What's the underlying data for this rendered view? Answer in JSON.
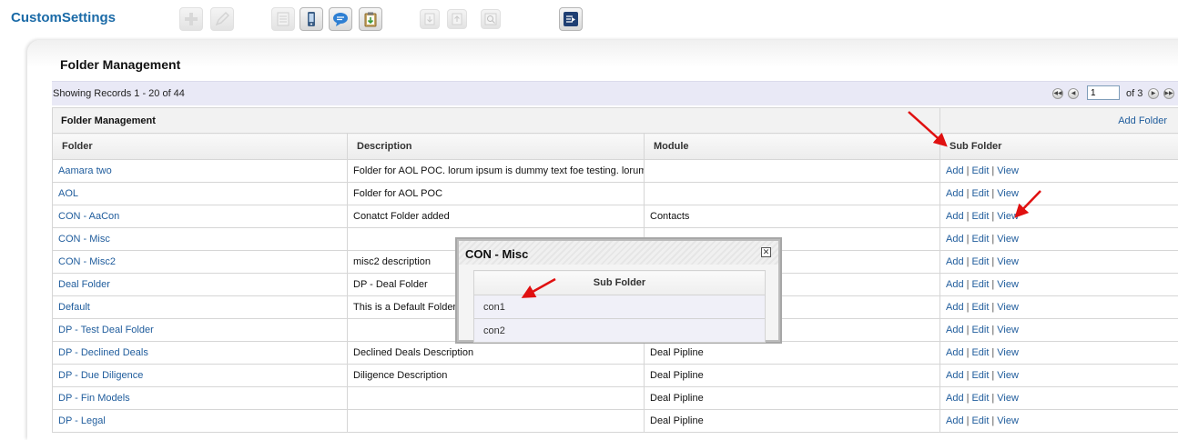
{
  "app": {
    "title": "CustomSettings"
  },
  "toolbar": {
    "buttons": [
      {
        "name": "add-icon",
        "state": "disabled"
      },
      {
        "name": "edit-icon",
        "state": "disabled"
      },
      {
        "name": "list-icon",
        "state": "disabled"
      },
      {
        "name": "mobile-icon",
        "state": "enabled"
      },
      {
        "name": "chat-bubble-icon",
        "state": "enabled"
      },
      {
        "name": "clipboard-icon",
        "state": "enabled"
      },
      {
        "name": "move-down-icon",
        "state": "disabled"
      },
      {
        "name": "move-up-icon",
        "state": "disabled"
      },
      {
        "name": "search-window-icon",
        "state": "disabled"
      },
      {
        "name": "export-icon",
        "state": "enabled"
      }
    ]
  },
  "panel": {
    "title": "Folder Management"
  },
  "records": {
    "summary": "Showing Records 1 - 20 of 44"
  },
  "pager": {
    "current_page": "1",
    "of_label": "of 3"
  },
  "grid": {
    "group_title": "Folder Management",
    "add_folder_label": "Add Folder",
    "columns": [
      "Folder",
      "Description",
      "Module",
      "Sub Folder"
    ],
    "action_labels": {
      "add": "Add",
      "edit": "Edit",
      "view": "View"
    },
    "rows": [
      {
        "folder": "Aamara two",
        "description": "Folder for AOL POC. lorum ipsum is dummy text foe testing. lorum ipsum is dummy text",
        "module": ""
      },
      {
        "folder": "AOL",
        "description": "Folder for AOL POC",
        "module": ""
      },
      {
        "folder": "CON - AaCon",
        "description": "Conatct Folder added",
        "module": "Contacts"
      },
      {
        "folder": "CON - Misc",
        "description": "",
        "module": ""
      },
      {
        "folder": "CON - Misc2",
        "description": "misc2 description",
        "module": ""
      },
      {
        "folder": "Deal Folder",
        "description": "DP - Deal Folder",
        "module": ""
      },
      {
        "folder": "Default",
        "description": "This is a Default Folder",
        "module": ""
      },
      {
        "folder": "DP - Test Deal Folder",
        "description": "",
        "module": ""
      },
      {
        "folder": "DP - Declined Deals",
        "description": "Declined Deals Description",
        "module": "Deal Pipline"
      },
      {
        "folder": "DP - Due Diligence",
        "description": "Diligence Description",
        "module": "Deal Pipline"
      },
      {
        "folder": "DP - Fin Models",
        "description": "",
        "module": "Deal Pipline"
      },
      {
        "folder": "DP - Legal",
        "description": "",
        "module": "Deal Pipline"
      }
    ]
  },
  "popup": {
    "title": "CON - Misc",
    "column_header": "Sub Folder",
    "items": [
      "con1",
      "con2"
    ]
  },
  "colors": {
    "link": "#1f5c9c",
    "title": "#1a6aa7",
    "annotation_arrow": "#e01010",
    "records_bar": "#e9e9f6"
  }
}
